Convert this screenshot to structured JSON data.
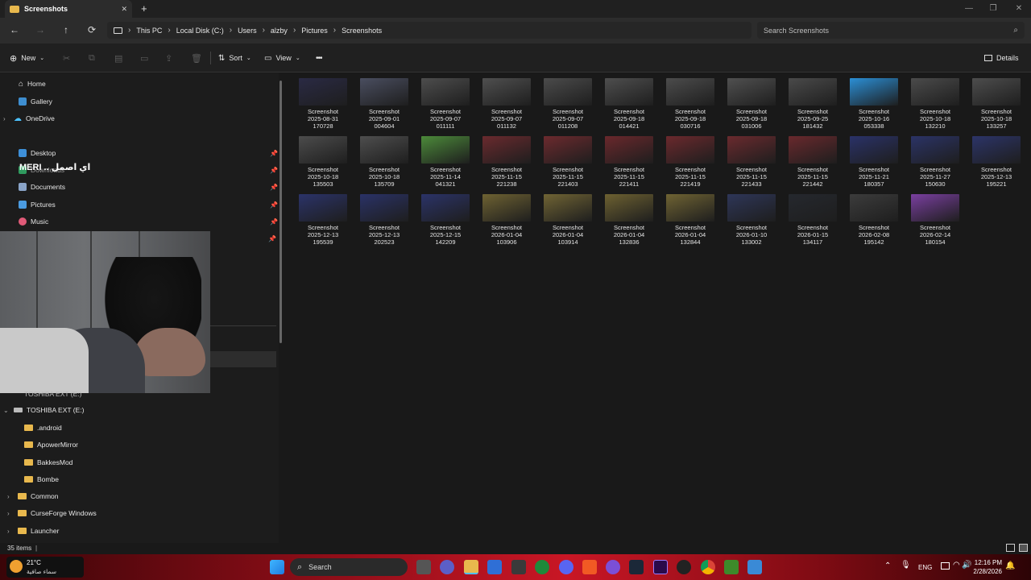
{
  "window": {
    "tab_title": "Screenshots",
    "close_tab": "✕",
    "new_tab": "+"
  },
  "nav": {
    "back": "←",
    "forward": "→",
    "up": "↑",
    "refresh": "⟳"
  },
  "breadcrumb": [
    "This PC",
    "Local Disk (C:)",
    "Users",
    "alzby",
    "Pictures",
    "Screenshots"
  ],
  "search": {
    "placeholder": "Search Screenshots"
  },
  "toolbar": {
    "new_label": "New",
    "sort_label": "Sort",
    "view_label": "View",
    "more_label": "•••",
    "details_label": "Details"
  },
  "sidebar": {
    "home": "Home",
    "gallery": "Gallery",
    "onedrive": "OneDrive",
    "desktop": "Desktop",
    "downloads": "Downloads",
    "documents": "Documents",
    "pictures": "Pictures",
    "music": "Music",
    "toshiba_hidden": "TOSHIBA EXT (E:)",
    "toshiba": "TOSHIBA EXT (E:)",
    "folders": [
      "android",
      "ApowerMirror",
      "BakkesMod",
      "Bombe",
      "Common",
      "CurseForge Windows",
      "Launcher"
    ]
  },
  "overlay_text": "اي اصمل .. MERI",
  "files": [
    {
      "name": "Screenshot",
      "date": "2025-08-31",
      "time": "170728",
      "color": "#2a2a44"
    },
    {
      "name": "Screenshot",
      "date": "2025-09-01",
      "time": "004604",
      "color": "#4a4e60"
    },
    {
      "name": "Screenshot",
      "date": "2025-09-07",
      "time": "011111",
      "color": "#4d4d4d"
    },
    {
      "name": "Screenshot",
      "date": "2025-09-07",
      "time": "011132",
      "color": "#4f4f4f"
    },
    {
      "name": "Screenshot",
      "date": "2025-09-07",
      "time": "011208",
      "color": "#4b4b4b"
    },
    {
      "name": "Screenshot",
      "date": "2025-09-18",
      "time": "014421",
      "color": "#4e4e4e"
    },
    {
      "name": "Screenshot",
      "date": "2025-09-18",
      "time": "030716",
      "color": "#4c4c4c"
    },
    {
      "name": "Screenshot",
      "date": "2025-09-18",
      "time": "031006",
      "color": "#505050"
    },
    {
      "name": "Screenshot",
      "date": "2025-09-25",
      "time": "181432",
      "color": "#4a4a4a"
    },
    {
      "name": "Screenshot",
      "date": "2025-10-16",
      "time": "053338",
      "color": "#2b8fd6"
    },
    {
      "name": "Screenshot",
      "date": "2025-10-18",
      "time": "132210",
      "color": "#4b4b4b"
    },
    {
      "name": "Screenshot",
      "date": "2025-10-18",
      "time": "133257",
      "color": "#4d4d4d"
    },
    {
      "name": "Screenshot",
      "date": "2025-10-18",
      "time": "135503",
      "color": "#4c4c4c"
    },
    {
      "name": "Screenshot",
      "date": "2025-10-18",
      "time": "135709",
      "color": "#4e4e4e"
    },
    {
      "name": "Screenshot",
      "date": "2025-11-14",
      "time": "041321",
      "color": "#4c8a3a"
    },
    {
      "name": "Screenshot",
      "date": "2025-11-15",
      "time": "221238",
      "color": "#6a2a2e"
    },
    {
      "name": "Screenshot",
      "date": "2025-11-15",
      "time": "221403",
      "color": "#6c2a2e"
    },
    {
      "name": "Screenshot",
      "date": "2025-11-15",
      "time": "221411",
      "color": "#6a282c"
    },
    {
      "name": "Screenshot",
      "date": "2025-11-15",
      "time": "221419",
      "color": "#6b292d"
    },
    {
      "name": "Screenshot",
      "date": "2025-11-15",
      "time": "221433",
      "color": "#6a2a2e"
    },
    {
      "name": "Screenshot",
      "date": "2025-11-15",
      "time": "221442",
      "color": "#69292d"
    },
    {
      "name": "Screenshot",
      "date": "2025-11-21",
      "time": "180357",
      "color": "#2a3268"
    },
    {
      "name": "Screenshot",
      "date": "2025-11-27",
      "time": "150630",
      "color": "#2b3366"
    },
    {
      "name": "Screenshot",
      "date": "2025-12-13",
      "time": "195221",
      "color": "#2c3468"
    },
    {
      "name": "Screenshot",
      "date": "2025-12-13",
      "time": "195539",
      "color": "#2b3369"
    },
    {
      "name": "Screenshot",
      "date": "2025-12-13",
      "time": "202523",
      "color": "#2a3267"
    },
    {
      "name": "Screenshot",
      "date": "2025-12-15",
      "time": "142209",
      "color": "#2b3368"
    },
    {
      "name": "Screenshot",
      "date": "2026-01-04",
      "time": "103906",
      "color": "#6e6232"
    },
    {
      "name": "Screenshot",
      "date": "2026-01-04",
      "time": "103914",
      "color": "#706434"
    },
    {
      "name": "Screenshot",
      "date": "2026-01-04",
      "time": "132836",
      "color": "#6d6131"
    },
    {
      "name": "Screenshot",
      "date": "2026-01-04",
      "time": "132844",
      "color": "#6f6333"
    },
    {
      "name": "Screenshot",
      "date": "2026-01-10",
      "time": "133002",
      "color": "#2e3658"
    },
    {
      "name": "Screenshot",
      "date": "2026-01-15",
      "time": "134117",
      "color": "#25282e"
    },
    {
      "name": "Screenshot",
      "date": "2026-02-08",
      "time": "195142",
      "color": "#3c3c3c"
    },
    {
      "name": "Screenshot",
      "date": "2026-02-14",
      "time": "180154",
      "color": "#7a3fa0"
    }
  ],
  "status": {
    "items": "35 items"
  },
  "taskbar": {
    "weather_temp": "21°C",
    "weather_desc": "سماء صافية",
    "search_label": "Search",
    "lang": "ENG",
    "time": "12:16 PM",
    "date": "2/28/2026"
  },
  "colors": {
    "accent": "#4cc2ff",
    "folder": "#e8b84d",
    "taskbar": "#c91625"
  }
}
